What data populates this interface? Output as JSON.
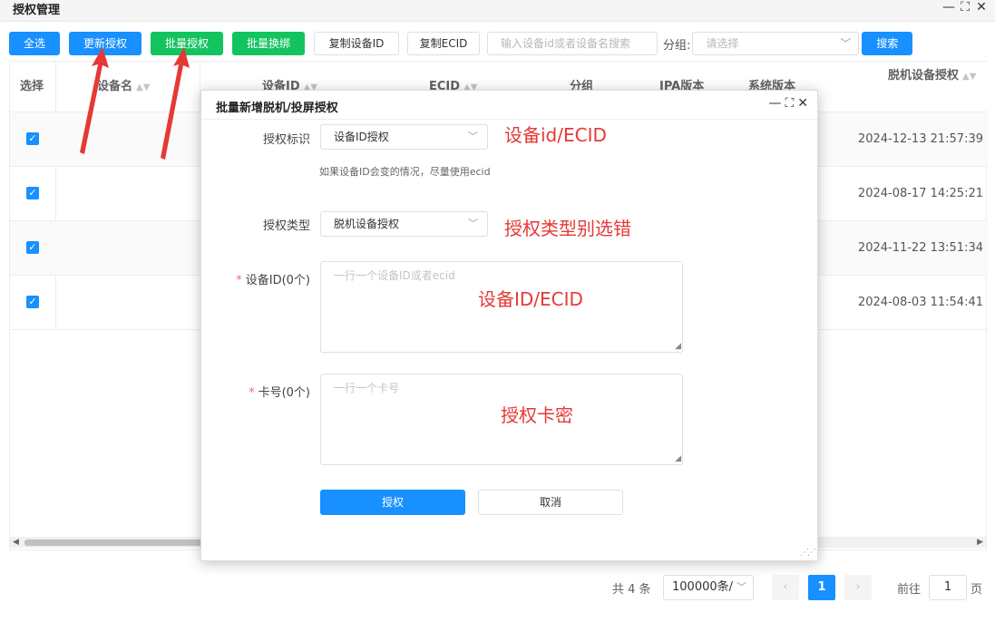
{
  "window": {
    "title": "授权管理",
    "controls": [
      "—",
      "⛶",
      "✕"
    ]
  },
  "toolbar": {
    "select_all": "全选",
    "update_auth": "更新授权",
    "batch_auth": "批量授权",
    "batch_rebind": "批量换绑",
    "copy_device_id": "复制设备ID",
    "copy_ecid": "复制ECID",
    "search_placeholder": "输入设备id或者设备名搜索",
    "group_label": "分组:",
    "group_placeholder": "请选择",
    "search_btn": "搜索"
  },
  "table": {
    "headers": {
      "select": "选择",
      "device_name": "设备名",
      "device_id": "设备ID",
      "ecid": "ECID",
      "group": "分组",
      "ipa_version": "IPA版本",
      "system_version": "系统版本",
      "offline_auth": "脱机设备授权"
    },
    "rows": [
      {
        "checked": true,
        "date": "2024-12-13 21:57:39"
      },
      {
        "checked": true,
        "date": "2024-08-17 14:25:21"
      },
      {
        "checked": true,
        "date": "2024-11-22 13:51:34"
      },
      {
        "checked": true,
        "date": "2024-08-03 11:54:41"
      }
    ]
  },
  "pagination": {
    "total": "共 4 条",
    "page_size": "100000条/",
    "current_page": "1",
    "goto_label": "前往",
    "goto_value": "1",
    "page_suffix": "页"
  },
  "modal": {
    "title": "批量新增脱机/投屏授权",
    "auth_identifier_label": "授权标识",
    "auth_identifier_value": "设备ID授权",
    "hint": "如果设备ID会变的情况，尽量使用ecid",
    "auth_type_label": "授权类型",
    "auth_type_value": "脱机设备授权",
    "device_id_label": "设备ID(0个)",
    "device_id_placeholder": "一行一个设备ID或者ecid",
    "card_label": "卡号(0个)",
    "card_placeholder": "一行一个卡号",
    "confirm": "授权",
    "cancel": "取消"
  },
  "annotations": {
    "a1": "设备id/ECID",
    "a2": "授权类型别选错",
    "a3": "设备ID/ECID",
    "a4": "授权卡密"
  },
  "colors": {
    "primary": "#1890ff",
    "success": "#13c45e",
    "annotation": "#e53935"
  }
}
